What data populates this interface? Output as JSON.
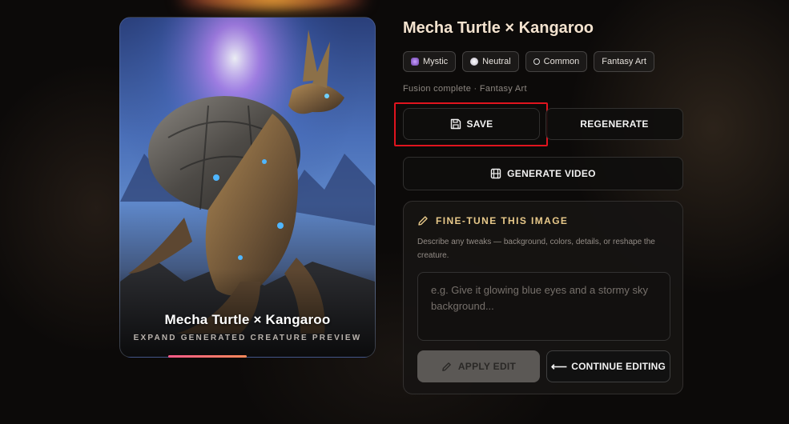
{
  "preview": {
    "title": "Mecha Turtle × Kangaroo",
    "subtitle": "EXPAND GENERATED CREATURE PREVIEW"
  },
  "creature": {
    "name": "Mecha Turtle × Kangaroo",
    "tags": [
      {
        "label": "Mystic",
        "icon": "crystal-ball-icon"
      },
      {
        "label": "Neutral",
        "icon": "neutral-dot-icon"
      },
      {
        "label": "Common",
        "icon": "ring-icon"
      },
      {
        "label": "Fantasy Art",
        "icon": ""
      }
    ],
    "status": "Fusion complete · Fantasy Art"
  },
  "actions": {
    "save_label": "SAVE",
    "regenerate_label": "REGENERATE",
    "generate_video_label": "GENERATE VIDEO"
  },
  "finetune": {
    "heading": "FINE-TUNE THIS IMAGE",
    "description": "Describe any tweaks — background, colors, details, or reshape the creature.",
    "placeholder": "e.g. Give it glowing blue eyes and a stormy sky background...",
    "apply_label": "APPLY EDIT",
    "continue_label": "CONTINUE EDITING"
  },
  "colors": {
    "accent_heading": "#e8c98a",
    "title_color": "#f4e3cf",
    "highlight_outline": "#e0141e",
    "progress_gradient_start": "#ff5a8a"
  }
}
